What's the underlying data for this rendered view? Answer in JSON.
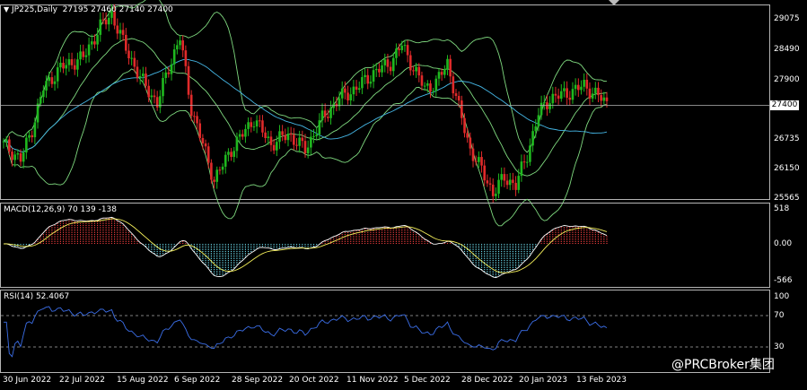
{
  "header": {
    "arrow": "▼",
    "title": "JP225,Daily",
    "ohlc": "27195 27460 27140 27400"
  },
  "price_axis": {
    "ticks": [
      "29075",
      "28490",
      "27900",
      "27400",
      "26735",
      "26150",
      "25565"
    ],
    "current": "27400"
  },
  "macd": {
    "label": "MACD(12,26,9) 70 139 -138",
    "ticks": [
      "518",
      "0.00",
      "-566"
    ]
  },
  "rsi": {
    "label": "RSI(14) 52.4067",
    "ticks": [
      "100",
      "70",
      "30"
    ]
  },
  "dates": [
    "30 Jun 2022",
    "22 Jul 2022",
    "15 Aug 2022",
    "6 Sep 2022",
    "28 Sep 2022",
    "20 Oct 2022",
    "11 Nov 2022",
    "5 Dec 2022",
    "28 Dec 2022",
    "20 Jan 2023",
    "13 Feb 2023"
  ],
  "watermark": "@PRCBroker集团",
  "colors": {
    "bull": "#1fb81f",
    "bear": "#e02a2a",
    "bands": "#7fd97f",
    "ma": "#45b7e6",
    "macd_hist_pos": "#e53b3b",
    "macd_hist_neg": "#6ad7e8",
    "signal": "#f4ef5a",
    "rsi": "#3b6ee8"
  },
  "chart_data": {
    "type": "candlestick",
    "price_ylim": [
      25565,
      29075
    ],
    "closes_control": [
      [
        0,
        26600
      ],
      [
        6,
        26300
      ],
      [
        10,
        26900
      ],
      [
        14,
        27700
      ],
      [
        20,
        28100
      ],
      [
        28,
        28300
      ],
      [
        34,
        28900
      ],
      [
        38,
        29150
      ],
      [
        42,
        28600
      ],
      [
        48,
        27900
      ],
      [
        54,
        27400
      ],
      [
        58,
        28100
      ],
      [
        62,
        28700
      ],
      [
        66,
        27300
      ],
      [
        70,
        26600
      ],
      [
        74,
        25900
      ],
      [
        80,
        26500
      ],
      [
        88,
        27100
      ],
      [
        94,
        26600
      ],
      [
        100,
        26800
      ],
      [
        106,
        26500
      ],
      [
        112,
        27100
      ],
      [
        118,
        27500
      ],
      [
        124,
        27700
      ],
      [
        130,
        28000
      ],
      [
        136,
        28200
      ],
      [
        140,
        28550
      ],
      [
        144,
        28100
      ],
      [
        148,
        27700
      ],
      [
        152,
        27800
      ],
      [
        156,
        28200
      ],
      [
        160,
        27300
      ],
      [
        164,
        26500
      ],
      [
        168,
        26100
      ],
      [
        172,
        25650
      ],
      [
        176,
        25950
      ],
      [
        180,
        25800
      ],
      [
        184,
        26400
      ],
      [
        188,
        27200
      ],
      [
        192,
        27500
      ],
      [
        198,
        27600
      ],
      [
        204,
        27750
      ],
      [
        210,
        27500
      ],
      [
        212,
        27400
      ]
    ]
  }
}
